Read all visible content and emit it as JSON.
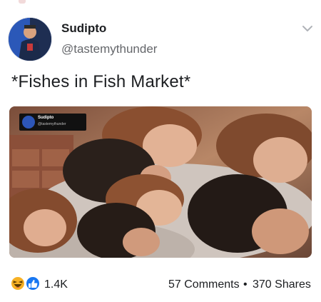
{
  "post": {
    "author_name": "Sudipto",
    "handle": "@tastemythunder",
    "caption": "*Fishes in Fish Market*",
    "image_alt": "Group of young people lying together with heads resting on each other"
  },
  "embedded_card": {
    "name": "Sudipto",
    "handle": "@tastemythunder"
  },
  "footer": {
    "reaction_count": "1.4K",
    "comments": "57 Comments",
    "separator": "•",
    "shares": "370 Shares"
  },
  "icons": {
    "menu": "chevron-down-icon",
    "reactions": [
      "haha-emoji-icon",
      "like-icon"
    ]
  },
  "colors": {
    "like_blue": "#1877f2",
    "haha_yellow": "#f7b125",
    "secondary_text": "#65676b"
  }
}
